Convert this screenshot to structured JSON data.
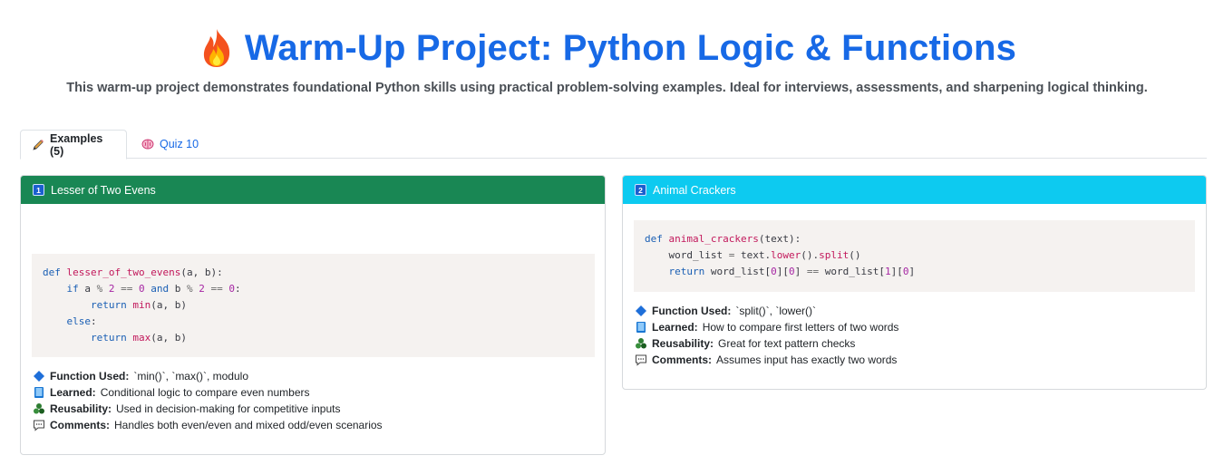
{
  "header": {
    "title": "Warm-Up Project: Python Logic & Functions",
    "subtitle": "This warm-up project demonstrates foundational Python skills using practical problem-solving examples. Ideal for interviews, assessments, and sharpening logical thinking."
  },
  "tabs": [
    {
      "label": "Examples (5)",
      "icon": "pencil-icon",
      "active": true
    },
    {
      "label": "Quiz 10",
      "icon": "brain-icon",
      "active": false
    }
  ],
  "cards": [
    {
      "number": "1",
      "title": "Lesser of Two Evens",
      "header_color": "#198754",
      "details": [
        {
          "icon": "diamond-icon",
          "label": "Function Used:",
          "text": "`min()`, `max()`, modulo"
        },
        {
          "icon": "book-icon",
          "label": "Learned:",
          "text": "Conditional logic to compare even numbers"
        },
        {
          "icon": "recycle-icon",
          "label": "Reusability:",
          "text": "Used in decision-making for competitive inputs"
        },
        {
          "icon": "speech-bubble-icon",
          "label": "Comments:",
          "text": "Handles both even/even and mixed odd/even scenarios"
        }
      ]
    },
    {
      "number": "2",
      "title": "Animal Crackers",
      "header_color": "#0dcaf0",
      "details": [
        {
          "icon": "diamond-icon",
          "label": "Function Used:",
          "text": "`split()`, `lower()`"
        },
        {
          "icon": "book-icon",
          "label": "Learned:",
          "text": "How to compare first letters of two words"
        },
        {
          "icon": "recycle-icon",
          "label": "Reusability:",
          "text": "Great for text pattern checks"
        },
        {
          "icon": "speech-bubble-icon",
          "label": "Comments:",
          "text": "Assumes input has exactly two words"
        }
      ]
    }
  ],
  "colors": {
    "accent": "#1769e6",
    "code_bg": "#f5f2f0"
  }
}
